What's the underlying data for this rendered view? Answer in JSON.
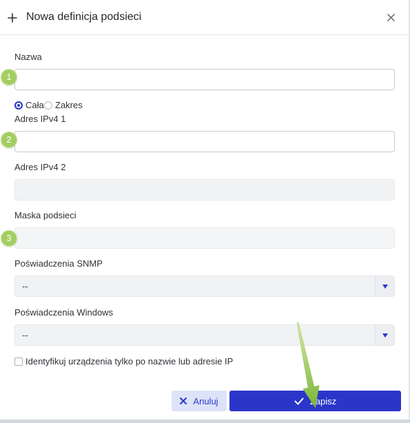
{
  "dialog": {
    "title": "Nowa definicja podsieci"
  },
  "form": {
    "name": {
      "label": "Nazwa",
      "value": ""
    },
    "scope": {
      "options": [
        {
          "label": "Cała",
          "selected": true
        },
        {
          "label": "Zakres",
          "selected": false
        }
      ]
    },
    "ipv4_address_1": {
      "label": "Adres IPv4 1",
      "value": ""
    },
    "ipv4_address_2": {
      "label": "Adres IPv4 2",
      "value": "",
      "disabled": true
    },
    "subnet_mask": {
      "label": "Maska podsieci",
      "value": "",
      "disabled": true
    },
    "snmp_credentials": {
      "label": "Poświadczenia SNMP",
      "selected": "--"
    },
    "windows_credentials": {
      "label": "Poświadczenia Windows",
      "selected": "--"
    },
    "identify_by_name_only": {
      "label": "Identyfikuj urządzenia tylko po nazwie lub adresie IP",
      "checked": false
    }
  },
  "footer": {
    "cancel_label": "Anuluj",
    "save_label": "Zapisz"
  },
  "annotations": {
    "markers": [
      "1",
      "2",
      "3"
    ],
    "arrow_target": "save-button"
  },
  "icons": {
    "header": "plus-icon",
    "close": "close-icon",
    "dropdown": "caret-down-icon",
    "cancel": "x-icon",
    "save": "check-icon"
  },
  "theme": {
    "accent": "#2b36c9",
    "cancel_background": "#dde3f8",
    "annotation": "#a2ce62",
    "disabled_field": "#f1f2f4"
  }
}
